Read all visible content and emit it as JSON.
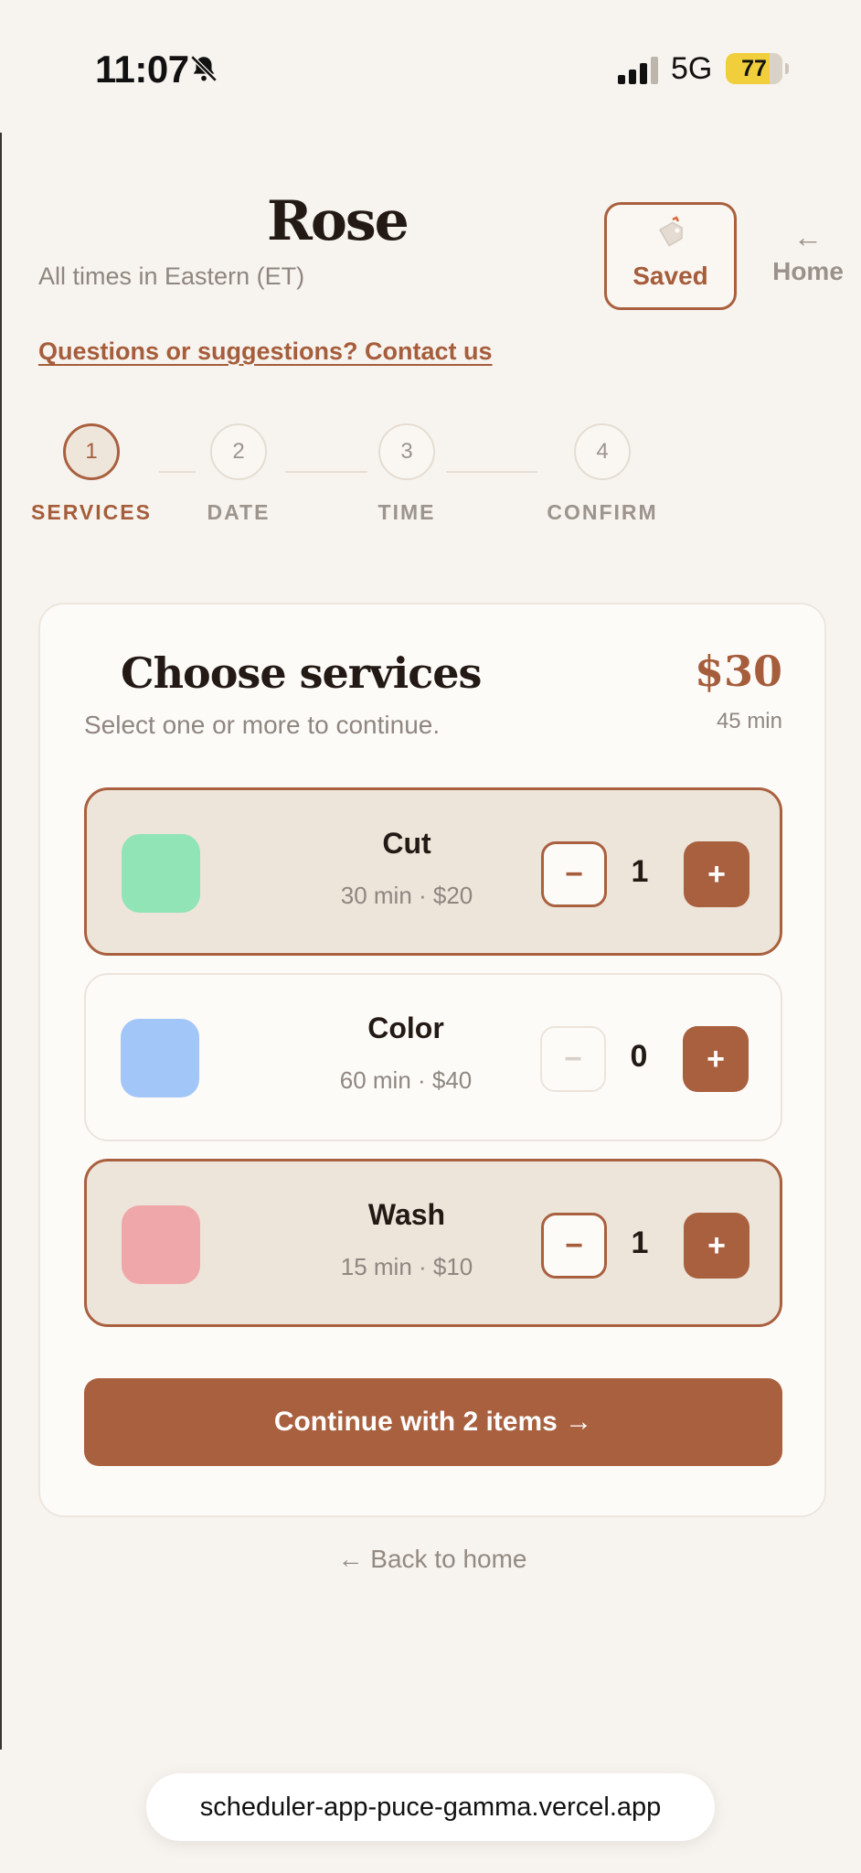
{
  "status_bar": {
    "time": "11:07",
    "network": "5G",
    "battery": "77"
  },
  "header": {
    "brand": "Rose",
    "timezone": "All times in Eastern (ET)",
    "saved_label": "Saved",
    "home_arrow": "←",
    "home_label": "Home",
    "contact_link": "Questions or suggestions? Contact us"
  },
  "steps": [
    {
      "number": "1",
      "label": "SERVICES",
      "active": true
    },
    {
      "number": "2",
      "label": "DATE",
      "active": false
    },
    {
      "number": "3",
      "label": "TIME",
      "active": false
    },
    {
      "number": "4",
      "label": "CONFIRM",
      "active": false
    }
  ],
  "card": {
    "title": "Choose services",
    "subtitle": "Select one or more to continue.",
    "total_price": "$30",
    "total_duration": "45 min"
  },
  "services": [
    {
      "name": "Cut",
      "meta": "30 min · $20",
      "qty": "1",
      "color": "#90e4b6",
      "selected": true,
      "minus": "−",
      "plus": "+"
    },
    {
      "name": "Color",
      "meta": "60 min · $40",
      "qty": "0",
      "color": "#a3c6f8",
      "selected": false,
      "minus": "−",
      "plus": "+"
    },
    {
      "name": "Wash",
      "meta": "15 min · $10",
      "qty": "1",
      "color": "#f0a7aa",
      "selected": true,
      "minus": "−",
      "plus": "+"
    }
  ],
  "continue_button": "Continue with 2 items →",
  "back_link": "← Back to home",
  "url": "scheduler-app-puce-gamma.vercel.app",
  "colors": {
    "accent": "#a9603f",
    "background": "#f7f3ee",
    "card": "#fdfbf8",
    "selected_row": "#ede5da"
  }
}
